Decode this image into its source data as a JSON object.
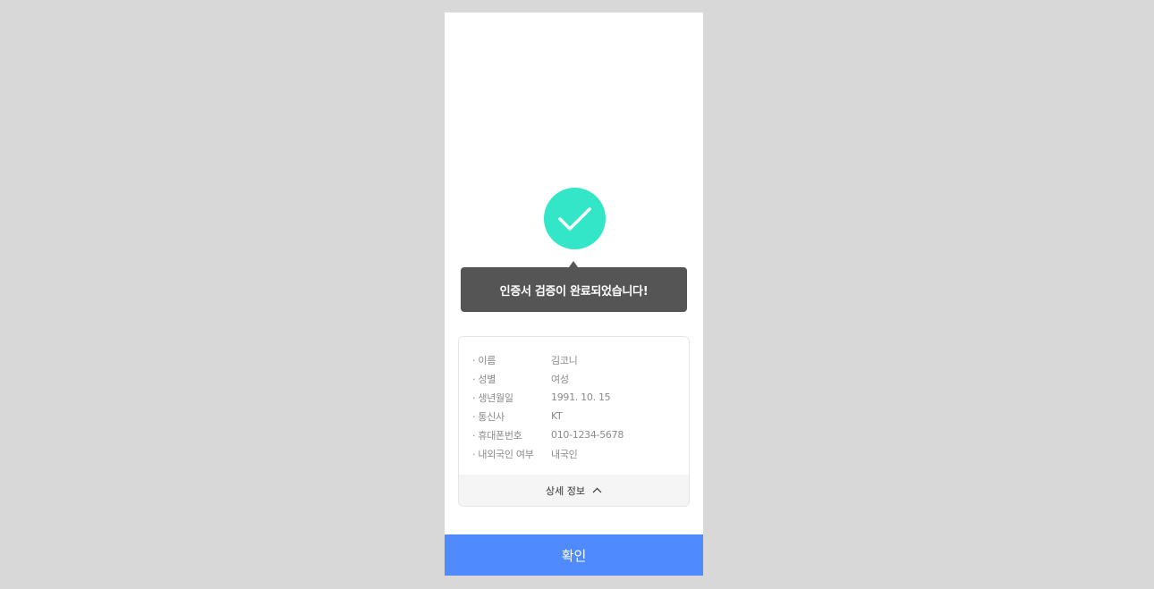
{
  "colors": {
    "accent": "#33e6c8",
    "primary": "#4f8bfd",
    "tooltip_bg": "#555555",
    "backdrop": "#d8d8d8"
  },
  "success": {
    "icon": "check-icon",
    "message": "인증서 검증이 완료되었습니다!"
  },
  "info": {
    "rows": [
      {
        "label": "이름",
        "value": "김코니"
      },
      {
        "label": "성별",
        "value": "여성"
      },
      {
        "label": "생년월일",
        "value": "1991. 10. 15"
      },
      {
        "label": "통신사",
        "value": "KT"
      },
      {
        "label": "휴대폰번호",
        "value": "010-1234-5678"
      },
      {
        "label": "내외국인 여부",
        "value": "내국인"
      }
    ],
    "detail_toggle": {
      "label": "상세 정보",
      "icon": "chevron-up-icon"
    }
  },
  "confirm_button": {
    "label": "확인"
  }
}
